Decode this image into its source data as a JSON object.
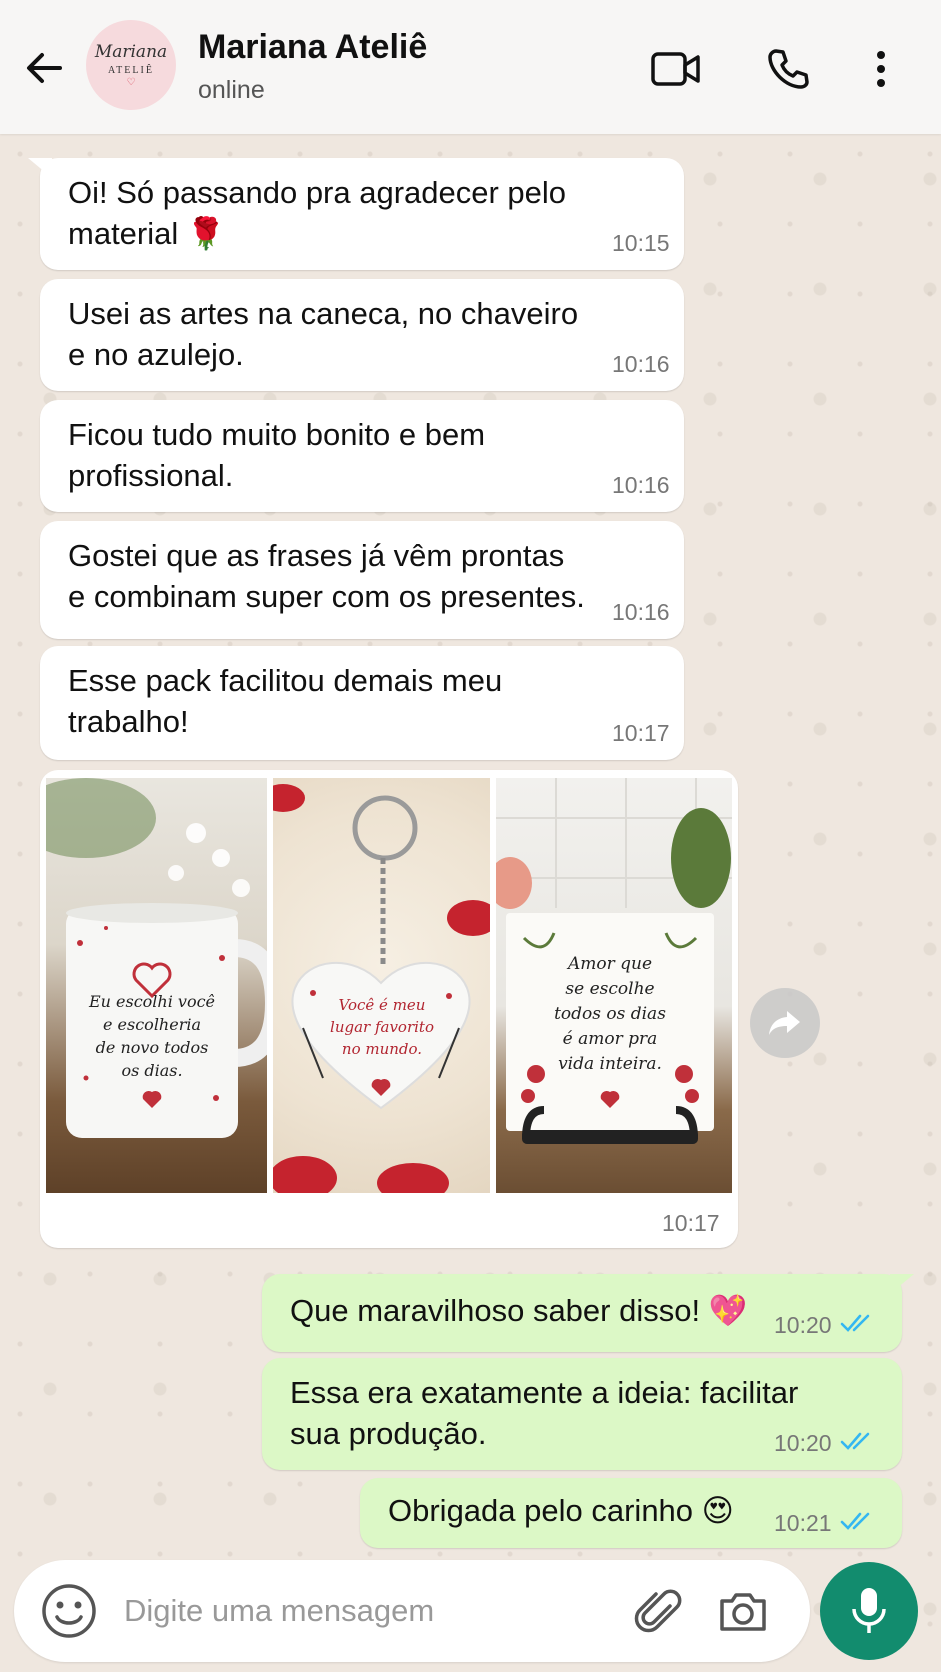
{
  "header": {
    "contact_name": "Mariana Ateliê",
    "status": "online",
    "avatar": {
      "line1": "Mariana",
      "line2": "ATELIÊ",
      "heart": "♡"
    },
    "icons": [
      "back-arrow-icon",
      "video-call-icon",
      "phone-icon",
      "more-options-icon"
    ]
  },
  "messages": [
    {
      "direction": "in",
      "text": "Oi! Só passando pra agradecer pelo\nmaterial 🌹",
      "time": "10:15"
    },
    {
      "direction": "in",
      "text": "Usei as artes na caneca, no chaveiro\ne no azulejo.",
      "time": "10:16"
    },
    {
      "direction": "in",
      "text": "Ficou tudo muito bonito e bem\nprofissional.",
      "time": "10:16"
    },
    {
      "direction": "in",
      "text": "Gostei que as frases já vêm prontas\ne combinam super com os presentes.",
      "time": "10:16"
    },
    {
      "direction": "in",
      "text": "Esse pack facilitou demais meu\ntrabalho!",
      "time": "10:17"
    },
    {
      "direction": "out",
      "text": "Que maravilhoso saber disso! 💖",
      "time": "10:20",
      "status": "read"
    },
    {
      "direction": "out",
      "text": "Essa era exatamente a ideia: facilitar\nsua produção.",
      "time": "10:20",
      "status": "read"
    },
    {
      "direction": "out",
      "text": "Obrigada pelo carinho 😍",
      "time": "10:21",
      "status": "read"
    }
  ],
  "image_message": {
    "time": "10:17",
    "photos": [
      {
        "subject": "mug",
        "text": "Eu escolhi você\ne escolheria\nde novo todos\nos dias."
      },
      {
        "subject": "heart-keychain",
        "text": "Você é meu\nlugar favorito\nno mundo."
      },
      {
        "subject": "tile-on-stand",
        "text": "Amor que\nse escolhe\ntodos os dias\né amor pra\nvida inteira."
      }
    ]
  },
  "composer": {
    "placeholder": "Digite uma mensagem",
    "value": ""
  },
  "colors": {
    "incoming_bubble": "#ffffff",
    "outgoing_bubble": "#dcf8c6",
    "chat_background": "#efe7df",
    "read_ticks": "#34b7f1",
    "mic_button": "#128c6e"
  }
}
